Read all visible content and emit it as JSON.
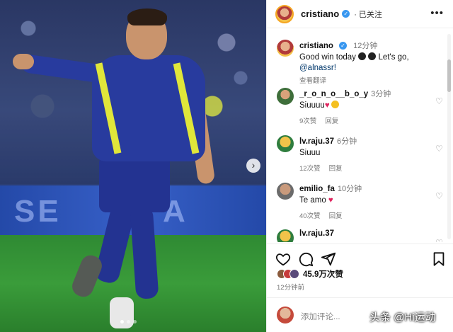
{
  "post": {
    "author": "cristiano",
    "follow_label": "· 已关注",
    "more_icon": "more-horizontal-icon",
    "caption_author": "cristiano",
    "caption_time": "12分钟",
    "caption_line1": "Good win today",
    "caption_line2_suffix": "Let's go,",
    "caption_mention": "@alnassr!",
    "translate_label": "查看翻译"
  },
  "photo": {
    "board_text_1": "SE",
    "board_text_2": "A"
  },
  "comments": [
    {
      "user": "_r_o_n_o__b_o_y",
      "time": "3分钟",
      "text": "Siuuuu",
      "likes": "9次赞",
      "reply": "回复"
    },
    {
      "user": "lv.raju.37",
      "time": "6分钟",
      "text": "Siuuu",
      "likes": "12次赞",
      "reply": "回复"
    },
    {
      "user": "emilio_fa",
      "time": "10分钟",
      "text": "Te amo",
      "likes": "40次赞",
      "reply": "回复"
    },
    {
      "user": "lv.raju.37",
      "time": "",
      "text": "",
      "likes": "",
      "reply": ""
    }
  ],
  "stats": {
    "likes_count": "45.9万次赞",
    "posted_ago": "12分钟前"
  },
  "composer": {
    "placeholder": "添加评论..."
  },
  "watermark": "头条 @Hi运动",
  "colors": {
    "verified_blue": "#3897f0",
    "heart_red": "#e0245e",
    "jersey_blue": "#283b9e",
    "jersey_yellow": "#e0e63a"
  }
}
